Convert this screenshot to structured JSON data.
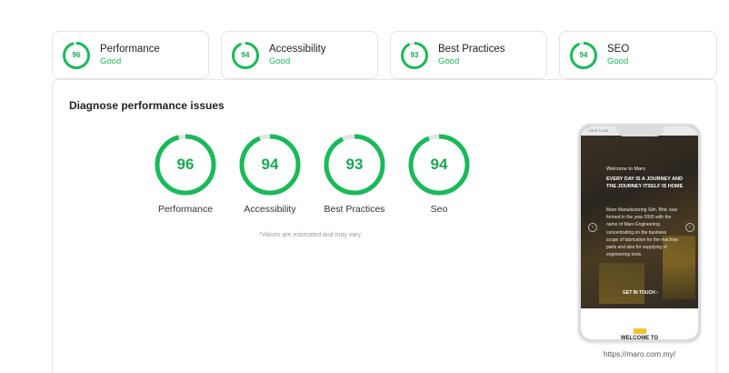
{
  "summary_cards": [
    {
      "score": "96",
      "score_value": 96,
      "title": "Performance",
      "status": "Good"
    },
    {
      "score": "94",
      "score_value": 94,
      "title": "Accessibility",
      "status": "Good"
    },
    {
      "score": "93",
      "score_value": 93,
      "title": "Best Practices",
      "status": "Good"
    },
    {
      "score": "94",
      "score_value": 94,
      "title": "SEO",
      "status": "Good"
    }
  ],
  "panel": {
    "title": "Diagnose performance issues",
    "gauges": [
      {
        "score": "96",
        "score_value": 96,
        "label": "Performance"
      },
      {
        "score": "94",
        "score_value": 94,
        "label": "Accessibility"
      },
      {
        "score": "93",
        "score_value": 93,
        "label": "Best Practices"
      },
      {
        "score": "94",
        "score_value": 94,
        "label": "Seo"
      }
    ],
    "note": "*Values are estimated and may vary."
  },
  "preview": {
    "topbar_text": "VIEW TOUR",
    "welcome": "Welcome to Maro",
    "headline": "EVERY DAY IS A JOURNEY AND THE JOURNEY ITSELF IS HOME",
    "body": "Maro Manufacturing Sdn. Bhd. was formed in the year 2005 with the name of Maro Engineering concentrating on the business scope of fabrication for the machine parts and also for supplying of engineering tools.",
    "cta": "GET IN TOUCH  ›",
    "prev_arrow": "‹",
    "next_arrow": "›",
    "lower_heading": "WELCOME TO",
    "url": "https://maro.com.my/"
  },
  "colors": {
    "good": "#1ab95a",
    "track": "#e4e4e4"
  }
}
